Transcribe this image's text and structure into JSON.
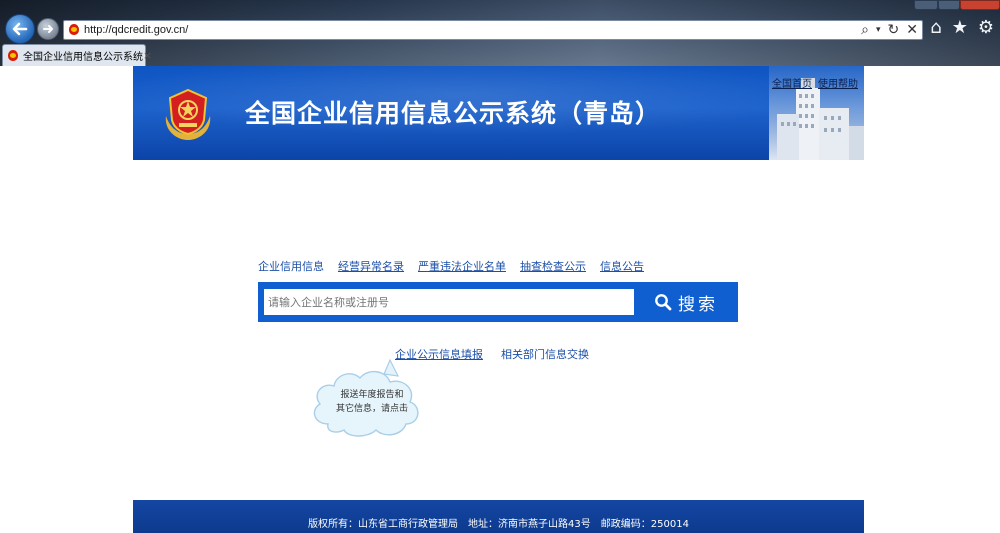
{
  "browser": {
    "url": "http://qdcredit.gov.cn/",
    "tab_title": "全国企业信用信息公示系统",
    "tab_close": "×",
    "toolbar_icons": [
      "home-icon",
      "star-icon",
      "gear-icon"
    ],
    "address_tools": [
      "search-icon",
      "dropdown-icon",
      "refresh-icon",
      "stop-icon"
    ]
  },
  "header": {
    "title": "全国企业信用信息公示系统（青岛）",
    "links": [
      "全国首页",
      "使用帮助"
    ]
  },
  "categories": [
    "企业信用信息",
    "经营异常名录",
    "严重违法企业名单",
    "抽查检查公示",
    "信息公告"
  ],
  "search": {
    "placeholder": "请输入企业名称或注册号",
    "button_label": "搜索"
  },
  "sub_links": [
    "企业公示信息填报",
    "相关部门信息交换"
  ],
  "cloud_tip": [
    "报送年度报告和",
    "其它信息，请点击"
  ],
  "footer": {
    "text": "版权所有：山东省工商行政管理局　地址：济南市燕子山路43号　邮政编码：250014"
  },
  "colors": {
    "banner_blue": "#1d62cc",
    "link_blue": "#1c4fa8",
    "search_blue": "#0f5fd0",
    "footer_blue": "#0d3a8e"
  }
}
